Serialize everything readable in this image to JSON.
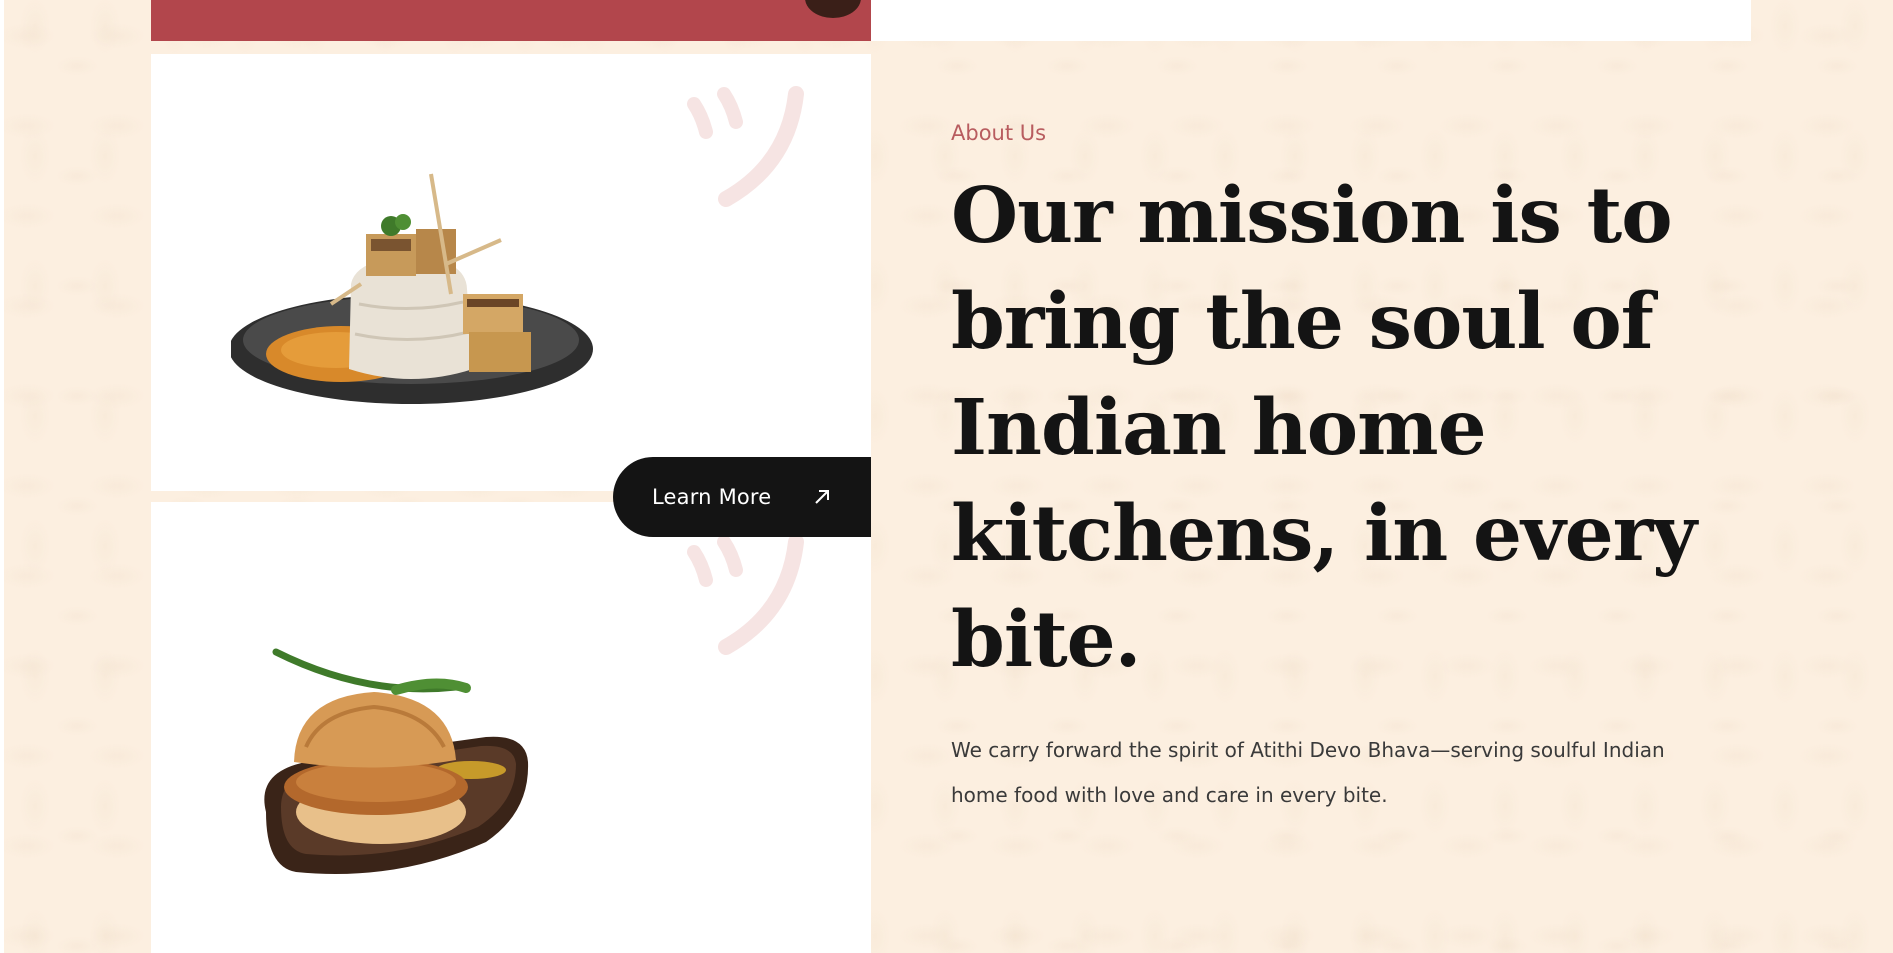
{
  "colors": {
    "background": "#fcefe0",
    "accent_red": "#b2464c",
    "eyebrow": "#b85c5f",
    "button_bg": "#141414",
    "heading": "#141414",
    "body_text": "#3a3a3a"
  },
  "gallery": {
    "images": [
      {
        "name": "paneer-tikka-rice-plate",
        "icon": "food-photo"
      },
      {
        "name": "vada-pav-on-board",
        "icon": "food-photo"
      }
    ],
    "learn_more": {
      "label": "Learn More",
      "icon": "arrow-up-right-icon"
    }
  },
  "about": {
    "eyebrow": "About Us",
    "headline": "Our mission is to bring the soul of Indian home kitchens, in every bite.",
    "description": "We carry forward the spirit of Atithi Devo Bhava—serving soulful Indian home food with love and care in every bite."
  }
}
